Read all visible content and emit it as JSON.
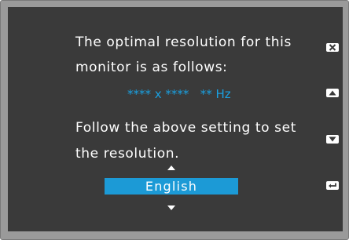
{
  "message": {
    "line1": "The optimal resolution for this",
    "line2": "monitor is as follows:",
    "resolution": "**** x ****   ** Hz",
    "line3": "Follow the above setting to set",
    "line4": "the resolution."
  },
  "language": {
    "selected": "English"
  },
  "side_buttons": [
    {
      "icon": "close-icon"
    },
    {
      "icon": "up-arrow-icon"
    },
    {
      "icon": "down-arrow-icon"
    },
    {
      "icon": "enter-icon"
    }
  ],
  "colors": {
    "screen_bg": "#3a3a3a",
    "frame": "#9a9a9a",
    "accent": "#1c9ad6",
    "resolution_text": "#1aa0e0"
  }
}
